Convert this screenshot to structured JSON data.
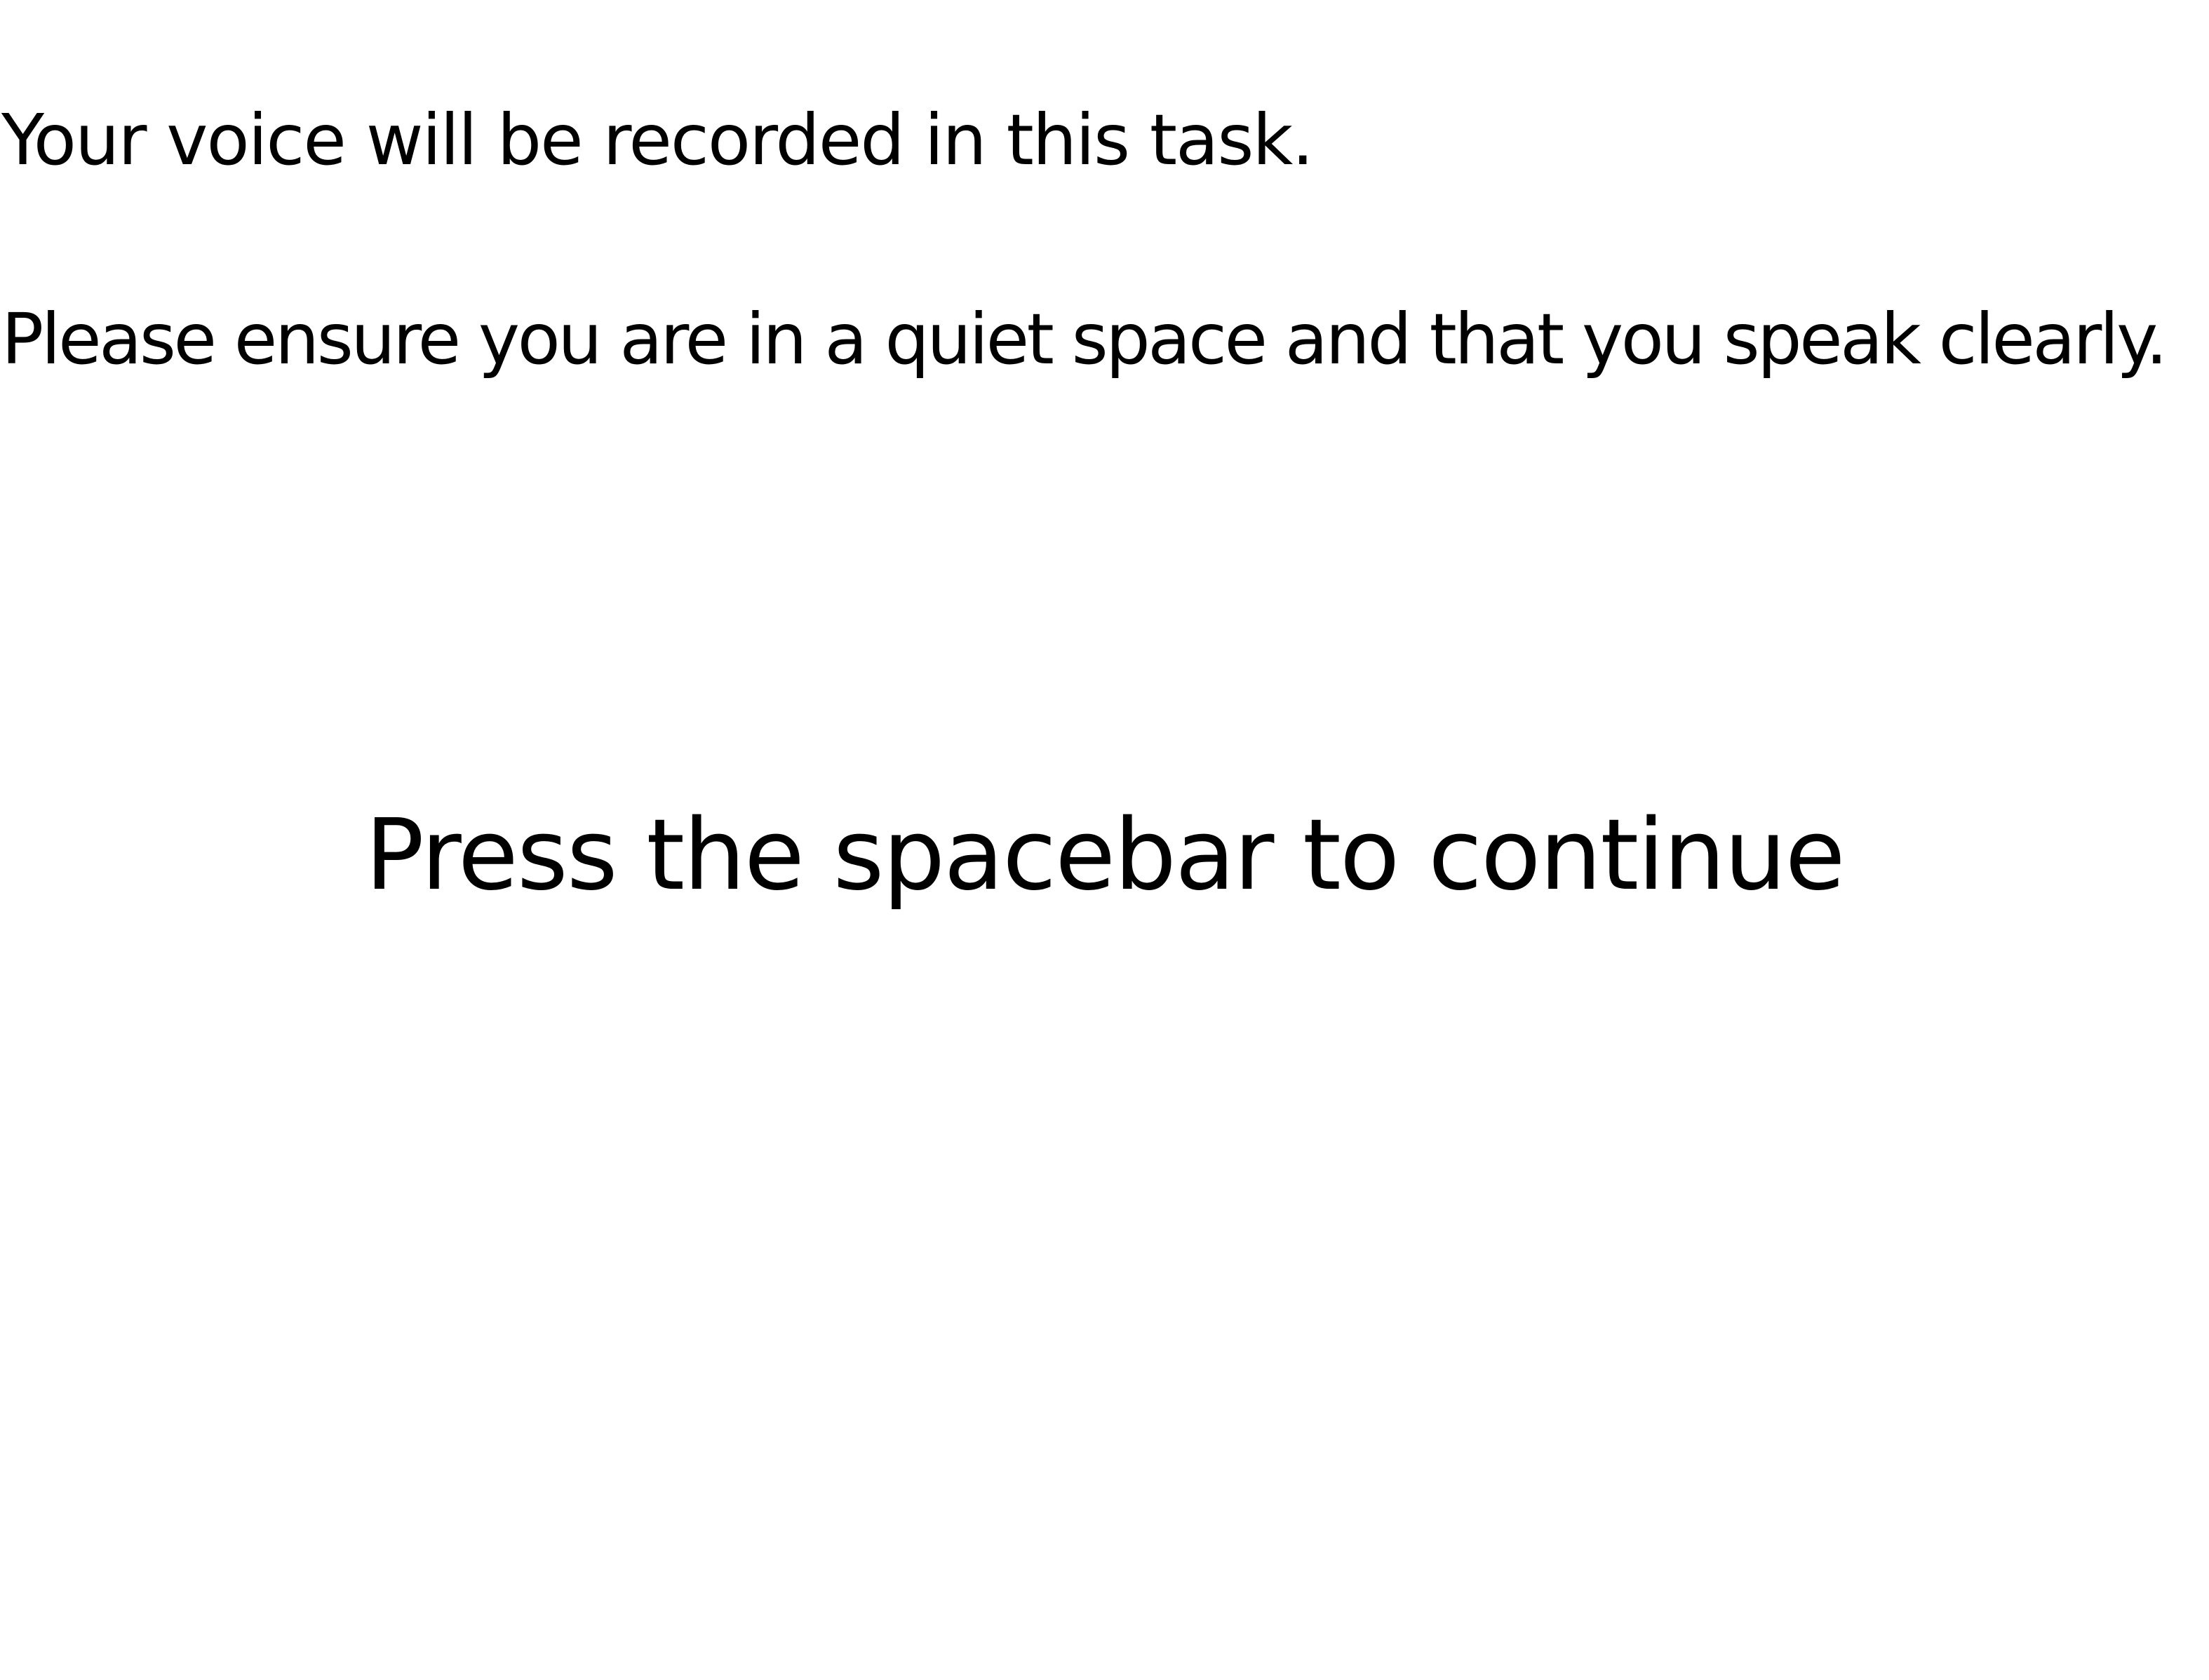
{
  "instructions": {
    "recording_notice": "Your voice will be recorded in this task.",
    "environment_notice": "Please ensure you are in a quiet space and that you speak clearly."
  },
  "prompt": {
    "continue_text": "Press the spacebar to continue"
  },
  "colors": {
    "background": "#ffffff",
    "text": "#000000"
  }
}
